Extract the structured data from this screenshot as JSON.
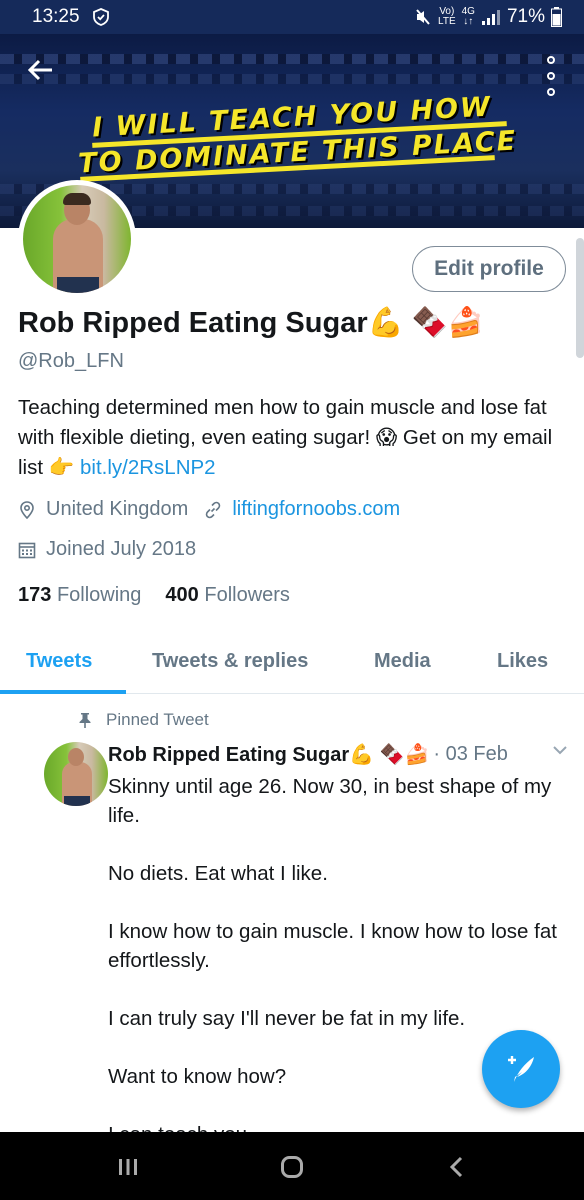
{
  "status_bar": {
    "time": "13:25",
    "volte_top": "Vo)",
    "volte_bottom": "LTE",
    "net_top": "4G",
    "net_bottom": "↓↑",
    "battery": "71%"
  },
  "banner": {
    "line1": "I WILL TEACH YOU HOW",
    "line2": "TO DOMINATE THIS PLACE",
    "back_icon": "arrow-left-icon",
    "more_icon": "more-vertical-icon"
  },
  "profile": {
    "edit_label": "Edit profile",
    "name": "Rob Ripped Eating Sugar💪 🍫🍰",
    "handle": "@Rob_LFN",
    "bio_text": "Teaching determined men how to gain muscle and lose fat with flexible dieting, even eating sugar! 😱  Get on my email list 👉 ",
    "bio_link": "bit.ly/2RsLNP2",
    "location": "United Kingdom",
    "website": "liftingfornoobs.com",
    "joined": "Joined July 2018",
    "following_count": "173",
    "following_label": "Following",
    "followers_count": "400",
    "followers_label": "Followers"
  },
  "tabs": [
    {
      "label": "Tweets",
      "active": true
    },
    {
      "label": "Tweets & replies",
      "active": false
    },
    {
      "label": "Media",
      "active": false
    },
    {
      "label": "Likes",
      "active": false
    }
  ],
  "tweet": {
    "pinned_label": "Pinned Tweet",
    "author": "Rob Ripped Eating Sugar💪 🍫🍰",
    "date": "· 03 Feb",
    "paragraphs": [
      "Skinny until age 26. Now 30, in best shape of my life.",
      "No diets. Eat what I like.",
      "I know how to gain muscle. I know how to lose fat effortlessly.",
      "I can truly say I'll never be fat in my life.",
      "Want to know how?",
      "I can teach you."
    ]
  },
  "colors": {
    "accent": "#1da1f2",
    "link": "#1b95e0",
    "secondary_text": "#657786",
    "banner_text": "#f5e62a"
  }
}
